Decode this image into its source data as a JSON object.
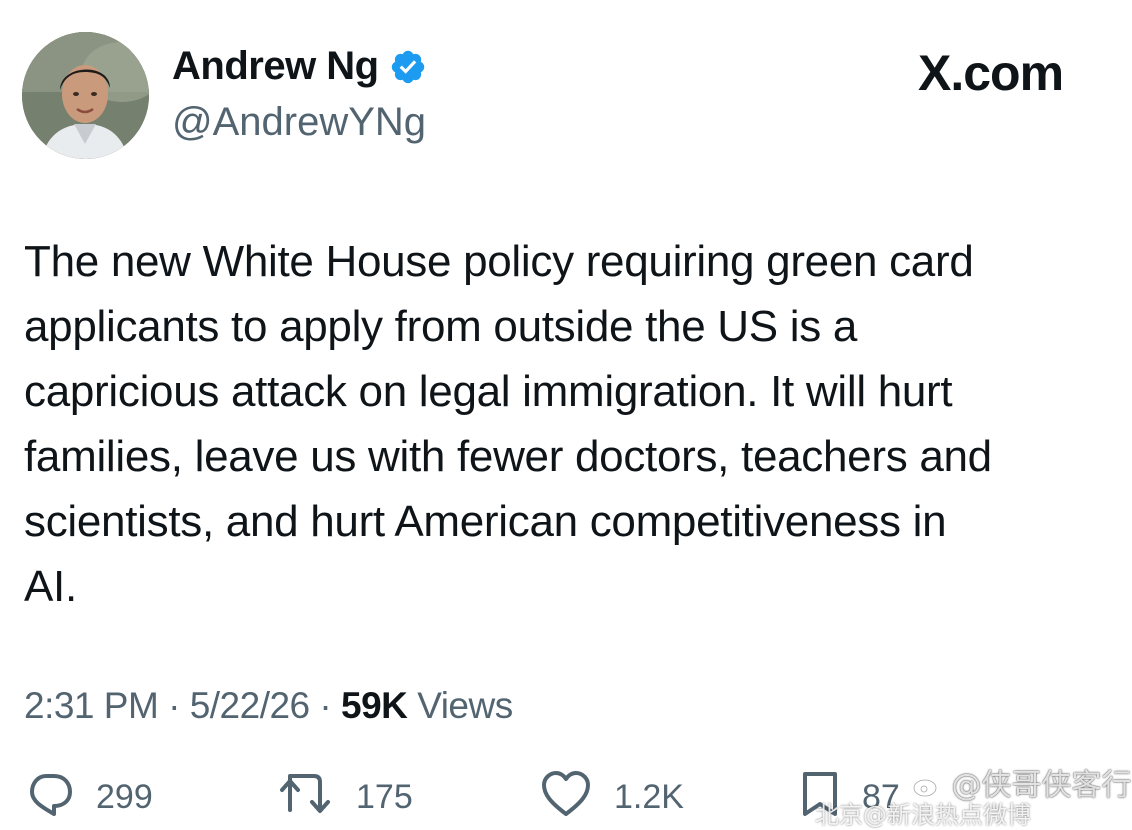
{
  "author": {
    "display_name": "Andrew Ng",
    "handle": "@AndrewYNg",
    "verified": true
  },
  "brand": {
    "label": "X.com"
  },
  "tweet": {
    "lines": [
      "The new White House policy requiring green card",
      "applicants to apply from outside the US is a",
      "capricious attack on legal immigration. It will hurt",
      "families, leave us with fewer doctors, teachers and",
      "scientists, and hurt American competitiveness in",
      "AI."
    ]
  },
  "meta": {
    "time": "2:31 PM",
    "separator": " · ",
    "date": "5/22/26",
    "views_count": "59K",
    "views_label": " Views"
  },
  "actions": {
    "replies": "299",
    "reposts": "175",
    "likes": "1.2K",
    "bookmarks": "87"
  },
  "watermark": {
    "text": "@侠哥侠客行",
    "text2": "北京@新浪热点微博"
  },
  "colors": {
    "verified": "#1d9bf0",
    "text": "#0f1419",
    "secondary": "#536471"
  },
  "icons": {
    "verified": "verified-badge-icon",
    "reply": "reply-icon",
    "repost": "repost-icon",
    "like": "heart-icon",
    "bookmark": "bookmark-icon",
    "weibo": "weibo-icon"
  }
}
